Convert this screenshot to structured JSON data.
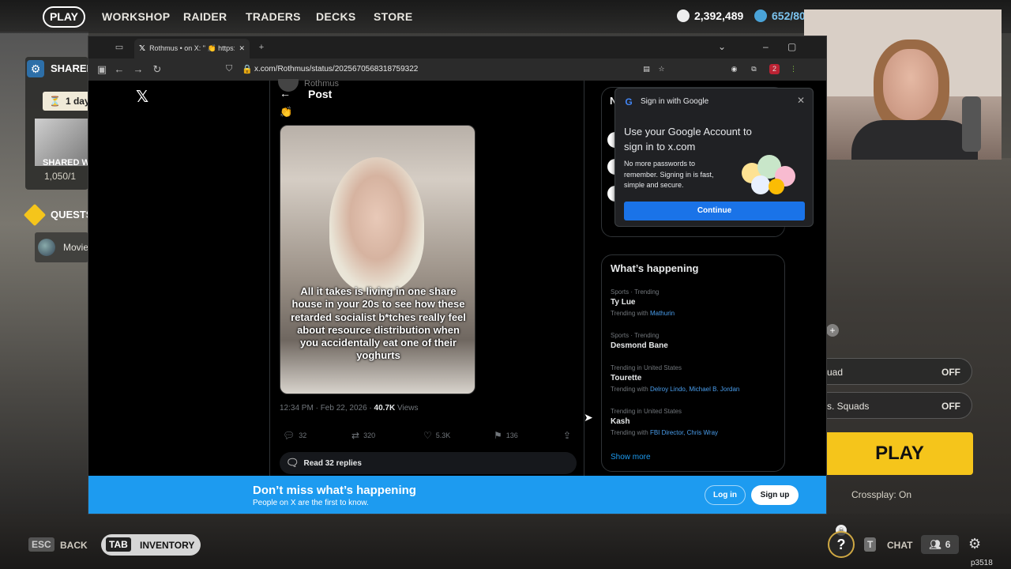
{
  "game": {
    "nav": {
      "play": "PLAY",
      "items": [
        "WORKSHOP",
        "RAIDER",
        "TRADERS",
        "DECKS",
        "STORE"
      ]
    },
    "currency": {
      "coins": "2,392,489",
      "tokens": "652/80"
    },
    "shared": {
      "label": "SHARED",
      "timer": "1 day",
      "name": "SHARED W",
      "cost": "1,050/1"
    },
    "quests": {
      "label": "QUESTS",
      "item": "Movie"
    },
    "options": [
      {
        "label": "uad",
        "value": "OFF"
      },
      {
        "label": "s. Squads",
        "value": "OFF"
      }
    ],
    "play_button": "PLAY",
    "crossplay": "Crossplay: On",
    "bottom": {
      "esc_key": "ESC",
      "back": "BACK",
      "tab_key": "TAB",
      "inventory": "INVENTORY",
      "chat_key": "T",
      "chat": "CHAT",
      "friends_count": "6",
      "build_id": "p3518"
    }
  },
  "browser": {
    "tab_title": "Rothmus • on X: \" 👏 https://",
    "url": "x.com/Rothmus/status/2025670568318759322",
    "badge_count": "2"
  },
  "x_page": {
    "logo": "X",
    "post_header_name": "Rothmus",
    "post_title": "Post",
    "post_text": "👏",
    "media_caption": "All it takes is living in one share house in your 20s to see how these retarded socialist b*tches really feel about resource distribution when you accidentally eat one of their yoghurts",
    "timestamp": "12:34 PM · Feb 22, 2026 · ",
    "views_count": "40.7K",
    "views_label": " Views",
    "actions": {
      "replies": "32",
      "reposts": "320",
      "likes": "5.3K",
      "bookmarks": "136"
    },
    "read_replies": "Read 32 replies",
    "top_box_letter": "N",
    "whats_happening": {
      "title": "What’s happening",
      "trends": [
        {
          "category": "Sports · Trending",
          "name": "Ty Lue",
          "with_prefix": "Trending with ",
          "with": "Mathurin"
        },
        {
          "category": "Sports · Trending",
          "name": "Desmond Bane",
          "with_prefix": "",
          "with": ""
        },
        {
          "category": "Trending in United States",
          "name": "Tourette",
          "with_prefix": "Trending with ",
          "with": "Delroy Lindo, Michael B. Jordan"
        },
        {
          "category": "Trending in United States",
          "name": "Kash",
          "with_prefix": "Trending with ",
          "with": "FBI Director, Chris Wray"
        }
      ],
      "show_more": "Show more"
    },
    "banner": {
      "title": "Don’t miss what’s happening",
      "subtitle": "People on X are the first to know.",
      "login": "Log in",
      "signup": "Sign up"
    }
  },
  "google_popup": {
    "header": "Sign in with Google",
    "title": "Use your Google Account to sign in to x.com",
    "description": "No more passwords to remember. Signing in is fast, simple and secure.",
    "button": "Continue"
  },
  "colors": {
    "x_blue": "#1d9bf0",
    "google_blue": "#1a73e8",
    "game_yellow": "#f5c51b"
  }
}
